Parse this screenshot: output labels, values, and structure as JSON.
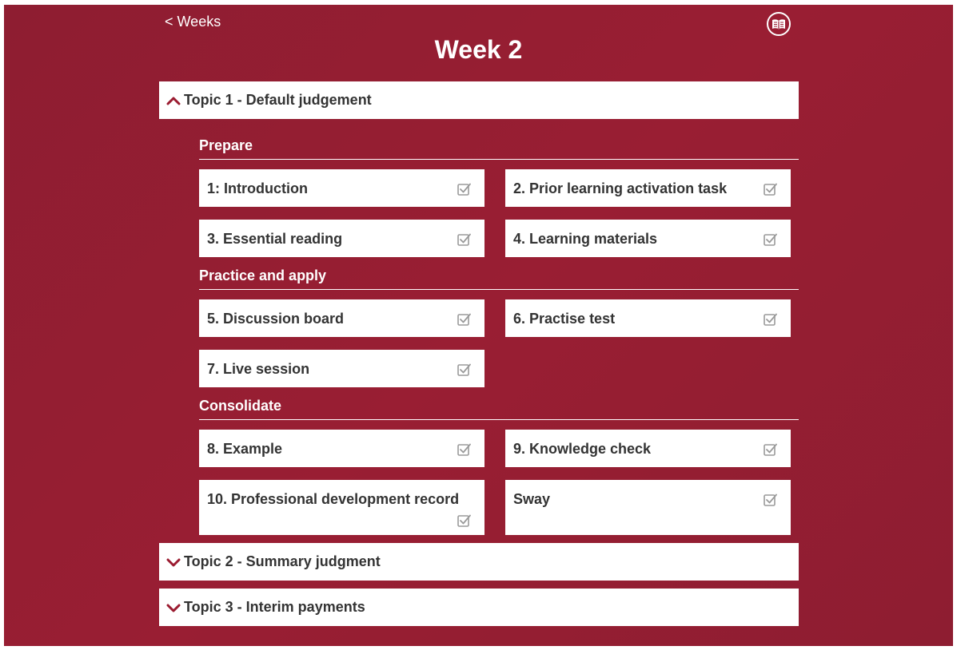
{
  "nav": {
    "back_label": "< Weeks",
    "book_icon": "book-icon"
  },
  "page": {
    "title": "Week 2"
  },
  "colors": {
    "background": "#991e33",
    "accent": "#9b1c31",
    "card": "#ffffff",
    "text": "#333333",
    "check": "#9a9a9a"
  },
  "topics": [
    {
      "label": "Topic 1 - Default judgement",
      "expanded": true,
      "sections": [
        {
          "title": "Prepare",
          "items": [
            {
              "label": "1: Introduction",
              "completed": true
            },
            {
              "label": "2. Prior learning activation task",
              "completed": true
            },
            {
              "label": "3. Essential reading",
              "completed": true
            },
            {
              "label": "4. Learning materials",
              "completed": true
            }
          ]
        },
        {
          "title": "Practice and apply",
          "items": [
            {
              "label": "5. Discussion board",
              "completed": true
            },
            {
              "label": "6. Practise test",
              "completed": true
            },
            {
              "label": "7. Live session",
              "completed": true
            }
          ]
        },
        {
          "title": "Consolidate",
          "items": [
            {
              "label": "8. Example",
              "completed": true
            },
            {
              "label": "9. Knowledge check",
              "completed": true
            },
            {
              "label": "10. Professional development record",
              "completed": true
            },
            {
              "label": "Sway",
              "completed": true
            }
          ]
        }
      ]
    },
    {
      "label": "Topic 2 - Summary judgment",
      "expanded": false
    },
    {
      "label": "Topic 3 - Interim payments",
      "expanded": false
    }
  ]
}
